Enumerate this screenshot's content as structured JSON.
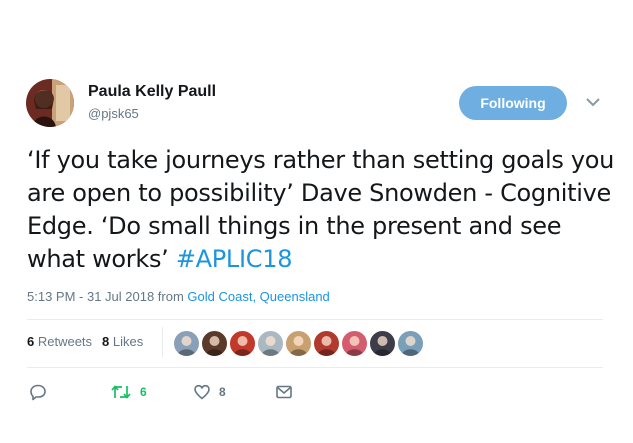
{
  "author": {
    "name": "Paula Kelly Paull",
    "handle": "@pjsk65"
  },
  "follow_button": {
    "label": "Following"
  },
  "tweet": {
    "text": "‘If you take journeys rather than setting goals you are open to possibility’ Dave Snowden - Cognitive Edge. ‘Do small things in the present and see what works’ ",
    "hashtag": "#APLIC18"
  },
  "meta": {
    "time_date": "5:13 PM - 31 Jul 2018 from ",
    "location": "Gold Coast, Queensland"
  },
  "stats": {
    "retweets_count": "6",
    "retweets_label": " Retweets",
    "likes_count": "8",
    "likes_label": " Likes"
  },
  "likers": [
    {
      "name": "liker-1",
      "color": "#8aa0b8"
    },
    {
      "name": "liker-2",
      "color": "#5a3a2a"
    },
    {
      "name": "liker-3",
      "color": "#c0392b"
    },
    {
      "name": "liker-4",
      "color": "#aab8c2"
    },
    {
      "name": "liker-5",
      "color": "#c9a070"
    },
    {
      "name": "liker-6",
      "color": "#b03a2e"
    },
    {
      "name": "liker-7",
      "color": "#d35c6e"
    },
    {
      "name": "liker-8",
      "color": "#3d3d4a"
    },
    {
      "name": "liker-9",
      "color": "#7a9fb8"
    }
  ],
  "actions": {
    "reply_icon": "reply-icon",
    "retweet_icon": "retweet-icon",
    "retweet_count": "6",
    "like_icon": "heart-icon",
    "like_count": "8",
    "dm_icon": "envelope-icon"
  },
  "colors": {
    "accent": "#1b95e0",
    "follow_button": "#6eaee0",
    "retweet_green": "#17bf63",
    "muted": "#657786"
  }
}
